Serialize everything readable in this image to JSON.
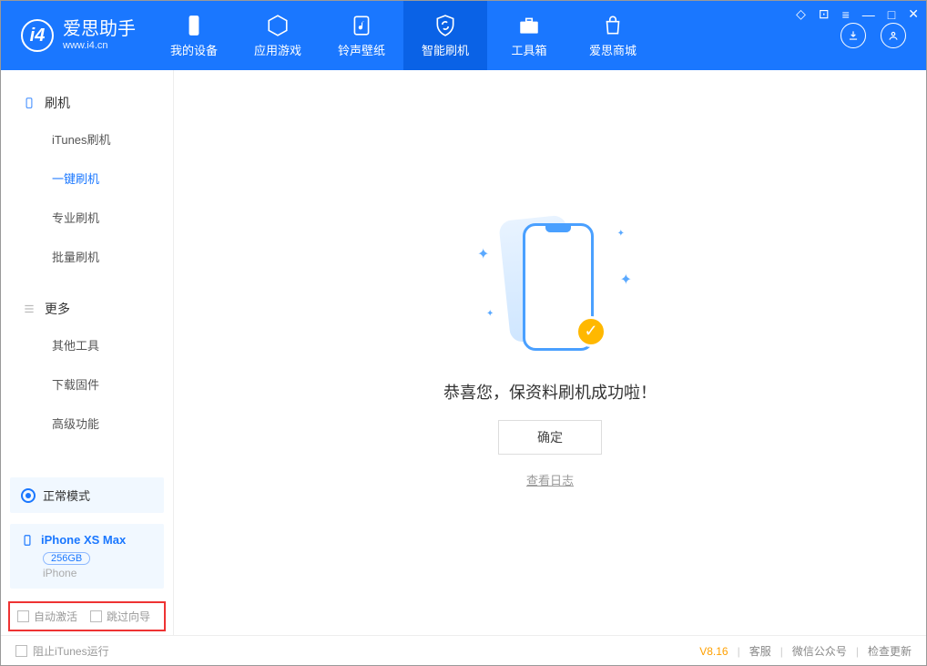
{
  "app": {
    "title": "爱思助手",
    "url": "www.i4.cn"
  },
  "nav": {
    "device": "我的设备",
    "apps": "应用游戏",
    "ringtone": "铃声壁纸",
    "flash": "智能刷机",
    "toolbox": "工具箱",
    "store": "爱思商城"
  },
  "sidebar": {
    "section1": "刷机",
    "items1": {
      "itunes": "iTunes刷机",
      "oneclick": "一键刷机",
      "pro": "专业刷机",
      "batch": "批量刷机"
    },
    "section2": "更多",
    "items2": {
      "other": "其他工具",
      "firmware": "下载固件",
      "advanced": "高级功能"
    }
  },
  "mode": {
    "label": "正常模式"
  },
  "device": {
    "name": "iPhone XS Max",
    "capacity": "256GB",
    "type": "iPhone"
  },
  "checks": {
    "auto_activate": "自动激活",
    "skip_setup": "跳过向导"
  },
  "main": {
    "success": "恭喜您，保资料刷机成功啦！",
    "ok": "确定",
    "view_log": "查看日志"
  },
  "footer": {
    "block_itunes": "阻止iTunes运行",
    "version": "V8.16",
    "support": "客服",
    "wechat": "微信公众号",
    "update": "检查更新"
  }
}
